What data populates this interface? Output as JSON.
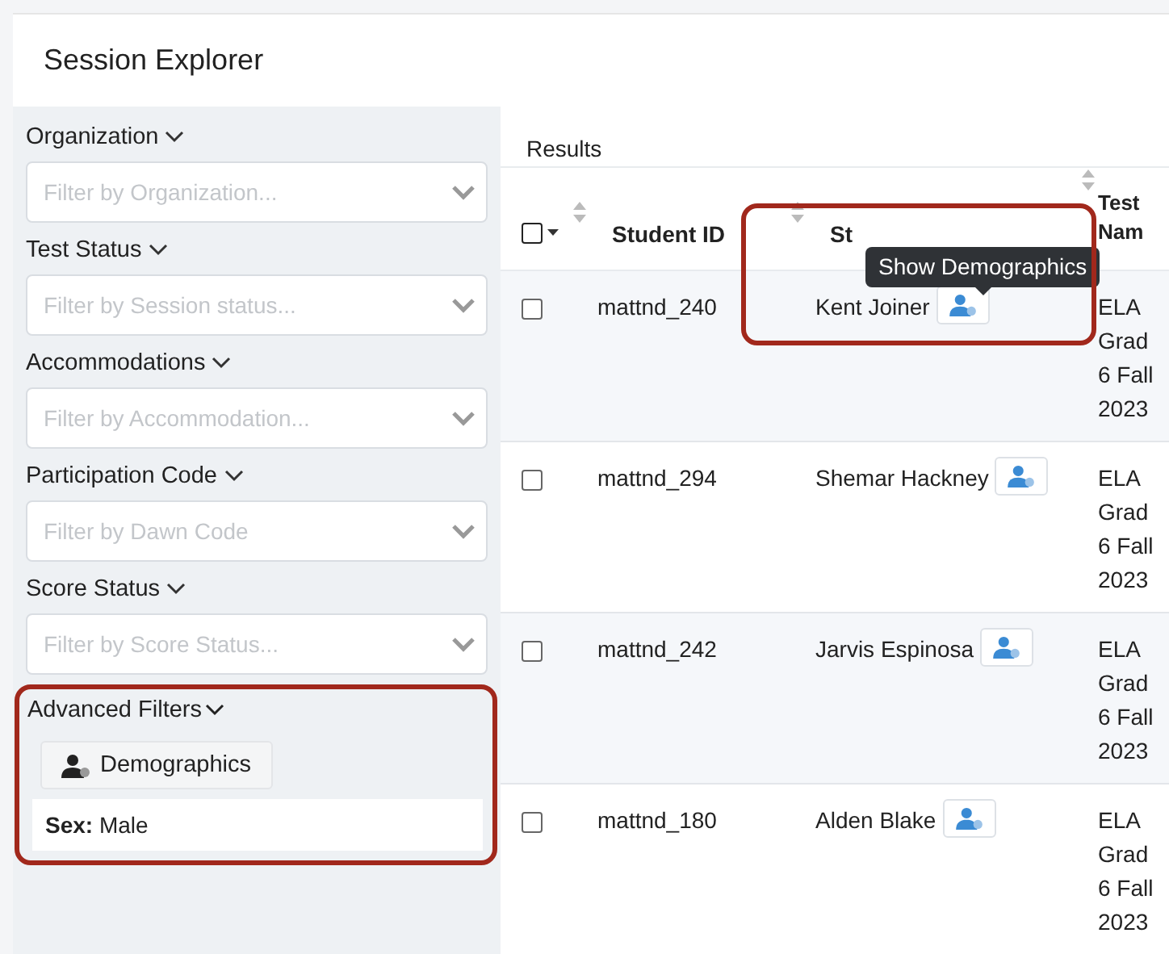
{
  "window": {
    "title": "Session Explorer"
  },
  "filters": [
    {
      "label": "Organization",
      "placeholder": "Filter by Organization..."
    },
    {
      "label": "Test Status",
      "placeholder": "Filter by Session status..."
    },
    {
      "label": "Accommodations",
      "placeholder": "Filter by Accommodation..."
    },
    {
      "label": "Participation Code",
      "placeholder": "Filter by Dawn Code"
    },
    {
      "label": "Score Status",
      "placeholder": "Filter by Score Status..."
    }
  ],
  "advanced_filters": {
    "label": "Advanced Filters",
    "button": "Demographics",
    "applied": [
      {
        "name": "Sex:",
        "value": "Male"
      }
    ]
  },
  "results": {
    "title": "Results",
    "select_all": {
      "checked": false
    },
    "columns": [
      "Student ID",
      "St",
      "Test Nam"
    ],
    "tooltip": "Show Demographics",
    "rows": [
      {
        "checked": false,
        "student_id": "mattnd_240",
        "name": "Kent Joiner",
        "test": "ELA Grad 6 Fall 2023"
      },
      {
        "checked": false,
        "student_id": "mattnd_294",
        "name": "Shemar Hackney",
        "test": "ELA Grad 6 Fall 2023"
      },
      {
        "checked": false,
        "student_id": "mattnd_242",
        "name": "Jarvis Espinosa",
        "test": "ELA Grad 6 Fall 2023"
      },
      {
        "checked": false,
        "student_id": "mattnd_180",
        "name": "Alden Blake",
        "test": "ELA Grad 6 Fall 2023"
      }
    ]
  }
}
